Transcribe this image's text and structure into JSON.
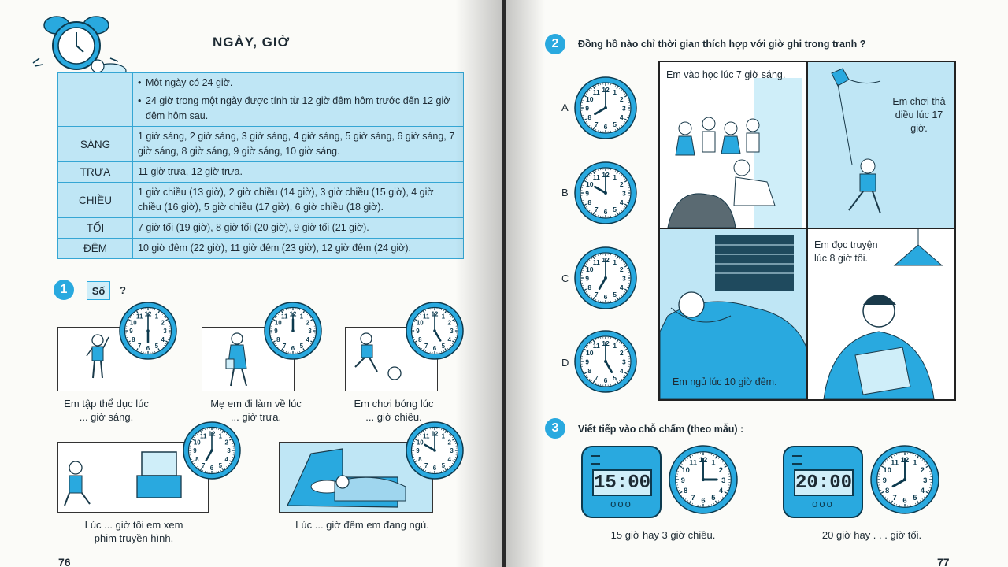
{
  "left_page": {
    "title": "NGÀY, GIỜ",
    "table": {
      "intro": [
        "Một ngày có 24 giờ.",
        "24 giờ trong một ngày được tính từ 12 giờ đêm hôm trước đến 12 giờ đêm hôm sau."
      ],
      "rows": [
        {
          "label": "SÁNG",
          "text": "1 giờ sáng, 2 giờ sáng, 3 giờ sáng, 4 giờ sáng, 5 giờ sáng, 6 giờ sáng, 7 giờ sáng, 8 giờ sáng, 9 giờ sáng, 10 giờ sáng."
        },
        {
          "label": "TRƯA",
          "text": "11 giờ trưa, 12 giờ trưa."
        },
        {
          "label": "CHIỀU",
          "text": "1 giờ chiều (13 giờ), 2 giờ chiều (14 giờ), 3 giờ chiều (15 giờ), 4 giờ chiều (16 giờ), 5 giờ chiều (17 giờ), 6 giờ chiều (18 giờ)."
        },
        {
          "label": "TỐI",
          "text": "7 giờ tối (19 giờ), 8 giờ tối (20 giờ), 9 giờ tối (21 giờ)."
        },
        {
          "label": "ĐÊM",
          "text": "10 giờ đêm (22 giờ), 11 giờ đêm (23 giờ), 12 giờ đêm (24 giờ)."
        }
      ]
    },
    "exercise1": {
      "number": "1",
      "label": "Số",
      "mark": "?",
      "items": [
        {
          "caption1": "Em tập thể dục lúc",
          "caption2": "... giờ sáng.",
          "hour": 6,
          "minute": 0
        },
        {
          "caption1": "Mẹ em đi làm về lúc",
          "caption2": "... giờ trưa.",
          "hour": 12,
          "minute": 0
        },
        {
          "caption1": "Em chơi bóng lúc",
          "caption2": "... giờ chiều.",
          "hour": 5,
          "minute": 0
        },
        {
          "caption1": "Lúc ... giờ tối em xem",
          "caption2": "phim truyền hình.",
          "hour": 7,
          "minute": 0
        },
        {
          "caption1": "Lúc ... giờ đêm em đang ngủ.",
          "caption2": "",
          "hour": 10,
          "minute": 0
        }
      ]
    },
    "page_number": "76"
  },
  "right_page": {
    "exercise2": {
      "number": "2",
      "question": "Đồng hồ nào chỉ thời gian thích hợp với giờ ghi trong tranh ?",
      "clocks": [
        {
          "label": "A",
          "hour": 8,
          "minute": 0
        },
        {
          "label": "B",
          "hour": 10,
          "minute": 0
        },
        {
          "label": "C",
          "hour": 7,
          "minute": 0
        },
        {
          "label": "D",
          "hour": 5,
          "minute": 0
        }
      ],
      "panels": [
        "Em vào học lúc 7 giờ sáng.",
        "Em chơi thả diều lúc 17 giờ.",
        "Em ngủ lúc 10 giờ đêm.",
        "Em đọc truyện lúc 8 giờ tối."
      ]
    },
    "exercise3": {
      "number": "3",
      "question": "Viết tiếp vào chỗ chấm (theo mẫu) :",
      "items": [
        {
          "digital": "15:00",
          "hour": 3,
          "minute": 0,
          "caption": "15 giờ hay 3 giờ chiều."
        },
        {
          "digital": "20:00",
          "hour": 8,
          "minute": 0,
          "caption": "20 giờ hay . . . giờ tối."
        }
      ],
      "buttons": "ooo"
    },
    "page_number": "77"
  },
  "colors": {
    "accent": "#29a9df",
    "table_bg": "#bfe6f5",
    "panel_bg": "#bfe6f5"
  }
}
